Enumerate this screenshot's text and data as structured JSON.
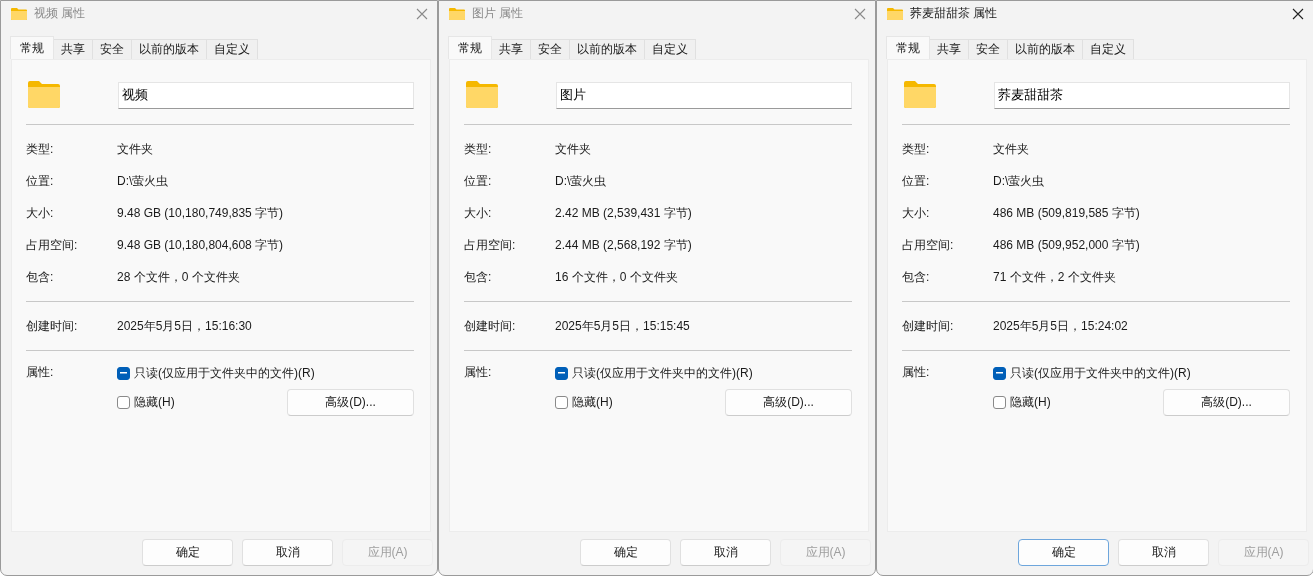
{
  "dialogs": [
    {
      "title": "视频 属性",
      "active": false,
      "tabs": [
        {
          "label": "常规",
          "selected": true
        },
        {
          "label": "共享",
          "selected": false
        },
        {
          "label": "安全",
          "selected": false
        },
        {
          "label": "以前的版本",
          "selected": false
        },
        {
          "label": "自定义",
          "selected": false
        }
      ],
      "name": "视频",
      "groups": [
        [
          {
            "label": "类型:",
            "value": "文件夹"
          },
          {
            "label": "位置:",
            "value": "D:\\萤火虫"
          },
          {
            "label": "大小:",
            "value": "9.48 GB (10,180,749,835 字节)"
          },
          {
            "label": "占用空间:",
            "value": "9.48 GB (10,180,804,608 字节)"
          },
          {
            "label": "包含:",
            "value": "28 个文件，0 个文件夹"
          }
        ],
        [
          {
            "label": "创建时间:",
            "value": "2025年5月5日，15:16:30"
          }
        ]
      ],
      "attributes_label": "属性:",
      "attributes": [
        {
          "label": "只读(仅应用于文件夹中的文件)(R)",
          "checked": true,
          "indeterminate": true
        },
        {
          "label": "隐藏(H)",
          "checked": false,
          "indeterminate": false
        }
      ],
      "advanced_button": "高级(D)...",
      "buttons": [
        {
          "label": "确定",
          "disabled": false,
          "focused": false
        },
        {
          "label": "取消",
          "disabled": false,
          "focused": false
        },
        {
          "label": "应用(A)",
          "disabled": true,
          "focused": false
        }
      ]
    },
    {
      "title": "图片 属性",
      "active": false,
      "tabs": [
        {
          "label": "常规",
          "selected": true
        },
        {
          "label": "共享",
          "selected": false
        },
        {
          "label": "安全",
          "selected": false
        },
        {
          "label": "以前的版本",
          "selected": false
        },
        {
          "label": "自定义",
          "selected": false
        }
      ],
      "name": "图片",
      "groups": [
        [
          {
            "label": "类型:",
            "value": "文件夹"
          },
          {
            "label": "位置:",
            "value": "D:\\萤火虫"
          },
          {
            "label": "大小:",
            "value": "2.42 MB (2,539,431 字节)"
          },
          {
            "label": "占用空间:",
            "value": "2.44 MB (2,568,192 字节)"
          },
          {
            "label": "包含:",
            "value": "16 个文件，0 个文件夹"
          }
        ],
        [
          {
            "label": "创建时间:",
            "value": "2025年5月5日，15:15:45"
          }
        ]
      ],
      "attributes_label": "属性:",
      "attributes": [
        {
          "label": "只读(仅应用于文件夹中的文件)(R)",
          "checked": true,
          "indeterminate": true
        },
        {
          "label": "隐藏(H)",
          "checked": false,
          "indeterminate": false
        }
      ],
      "advanced_button": "高级(D)...",
      "buttons": [
        {
          "label": "确定",
          "disabled": false,
          "focused": false
        },
        {
          "label": "取消",
          "disabled": false,
          "focused": false
        },
        {
          "label": "应用(A)",
          "disabled": true,
          "focused": false
        }
      ]
    },
    {
      "title": "荞麦甜甜茶 属性",
      "active": true,
      "tabs": [
        {
          "label": "常规",
          "selected": true
        },
        {
          "label": "共享",
          "selected": false
        },
        {
          "label": "安全",
          "selected": false
        },
        {
          "label": "以前的版本",
          "selected": false
        },
        {
          "label": "自定义",
          "selected": false
        }
      ],
      "name": "荞麦甜甜茶",
      "groups": [
        [
          {
            "label": "类型:",
            "value": "文件夹"
          },
          {
            "label": "位置:",
            "value": "D:\\萤火虫"
          },
          {
            "label": "大小:",
            "value": "486 MB (509,819,585 字节)"
          },
          {
            "label": "占用空间:",
            "value": "486 MB (509,952,000 字节)"
          },
          {
            "label": "包含:",
            "value": "71 个文件，2 个文件夹"
          }
        ],
        [
          {
            "label": "创建时间:",
            "value": "2025年5月5日，15:24:02"
          }
        ]
      ],
      "attributes_label": "属性:",
      "attributes": [
        {
          "label": "只读(仅应用于文件夹中的文件)(R)",
          "checked": true,
          "indeterminate": true
        },
        {
          "label": "隐藏(H)",
          "checked": false,
          "indeterminate": false
        }
      ],
      "advanced_button": "高级(D)...",
      "buttons": [
        {
          "label": "确定",
          "disabled": false,
          "focused": true
        },
        {
          "label": "取消",
          "disabled": false,
          "focused": false
        },
        {
          "label": "应用(A)",
          "disabled": true,
          "focused": false
        }
      ]
    }
  ]
}
